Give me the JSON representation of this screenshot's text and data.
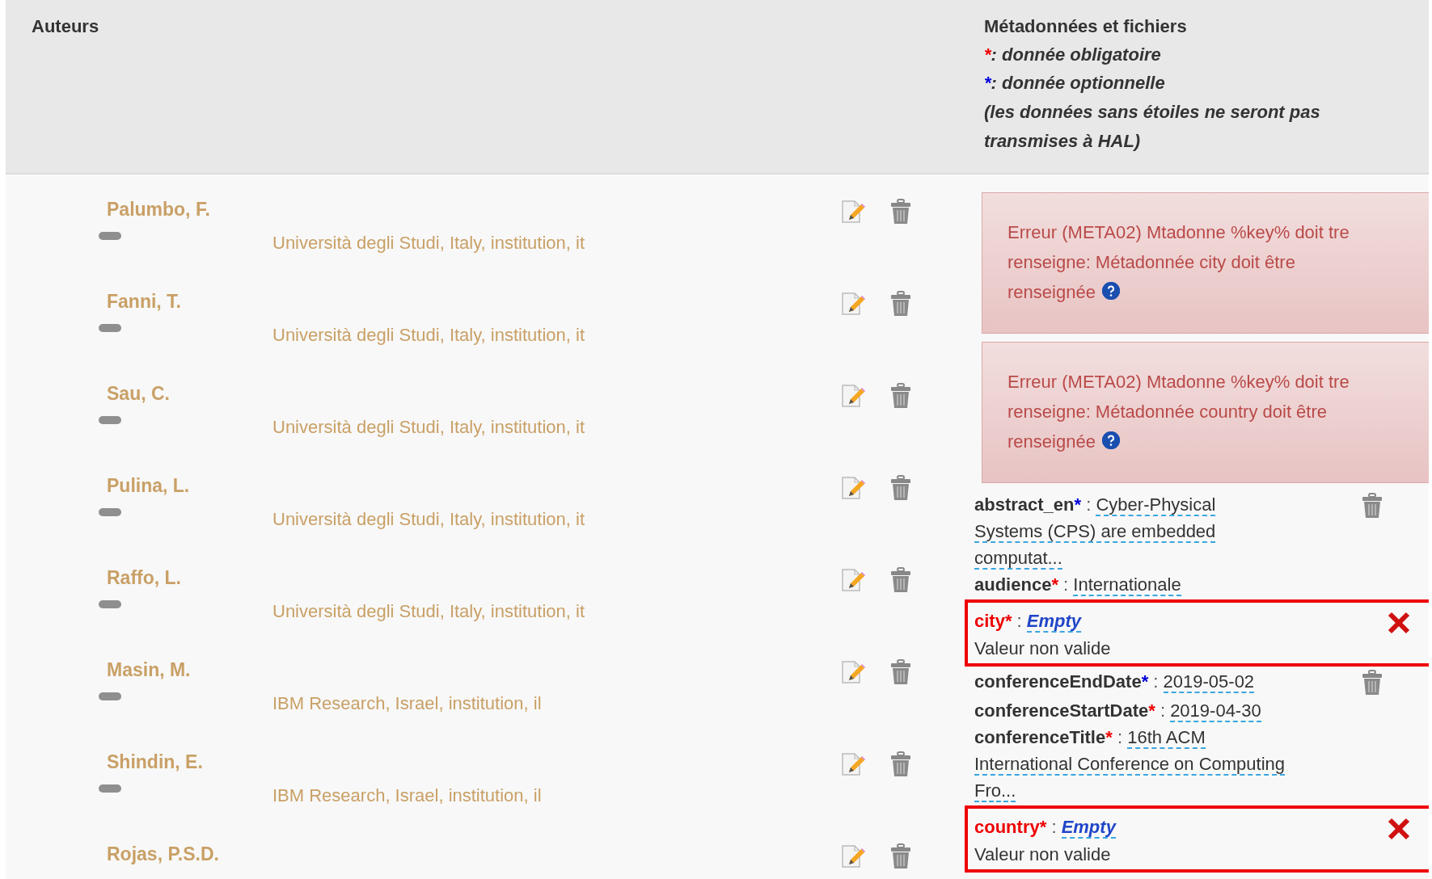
{
  "header": {
    "authors_title": "Auteurs",
    "metadata_title": "Métadonnées et fichiers",
    "legend": [
      {
        "required": true,
        "star": "*",
        "text": ": donnée obligatoire"
      },
      {
        "required": false,
        "star": "*",
        "text": ": donnée optionnelle"
      }
    ],
    "note": "(les données sans étoiles ne seront pas transmises à HAL)"
  },
  "authors": [
    {
      "name": "Palumbo, F.",
      "affiliation": "Università degli Studi, Italy, institution, it"
    },
    {
      "name": "Fanni, T.",
      "affiliation": "Università degli Studi, Italy, institution, it"
    },
    {
      "name": "Sau, C.",
      "affiliation": "Università degli Studi, Italy, institution, it"
    },
    {
      "name": "Pulina, L.",
      "affiliation": "Università degli Studi, Italy, institution, it"
    },
    {
      "name": "Raffo, L.",
      "affiliation": "Università degli Studi, Italy, institution, it"
    },
    {
      "name": "Masin, M.",
      "affiliation": "IBM Research, Israel, institution, il"
    },
    {
      "name": "Shindin, E.",
      "affiliation": "IBM Research, Israel, institution, il"
    },
    {
      "name": "Rojas, P.S.D."
    }
  ],
  "errors": [
    {
      "message": "Erreur (META02) Mtadonne %key% doit tre renseigne: Métadonnée city doit être renseignée"
    },
    {
      "message": "Erreur (META02) Mtadonne %key% doit tre renseigne: Métadonnée country doit être renseignée"
    }
  ],
  "metadata": [
    {
      "kind": "field",
      "key": "abstract_en",
      "required": false,
      "star": "*",
      "separator": ":",
      "value": "Cyber-Physical Systems (CPS) are embedded computat...",
      "deletable": true
    },
    {
      "kind": "field",
      "key": "audience",
      "required": true,
      "star": "*",
      "separator": ":",
      "value": "Internationale",
      "deletable": false
    },
    {
      "kind": "invalid",
      "key": "city",
      "required": true,
      "star": "*",
      "separator": ":",
      "value": "Empty",
      "message": "Valeur non valide"
    },
    {
      "kind": "field",
      "key": "conferenceEndDate",
      "required": false,
      "star": "*",
      "separator": ":",
      "value": "2019-05-02",
      "deletable": true
    },
    {
      "kind": "field",
      "key": "conferenceStartDate",
      "required": true,
      "star": "*",
      "separator": ":",
      "value": "2019-04-30",
      "deletable": false
    },
    {
      "kind": "field",
      "key": "conferenceTitle",
      "required": true,
      "star": "*",
      "separator": ":",
      "value": "16th ACM International Conference on Computing Fro...",
      "deletable": false
    },
    {
      "kind": "invalid",
      "key": "country",
      "required": true,
      "star": "*",
      "separator": ":",
      "value": "Empty",
      "message": "Valeur non valide"
    }
  ]
}
